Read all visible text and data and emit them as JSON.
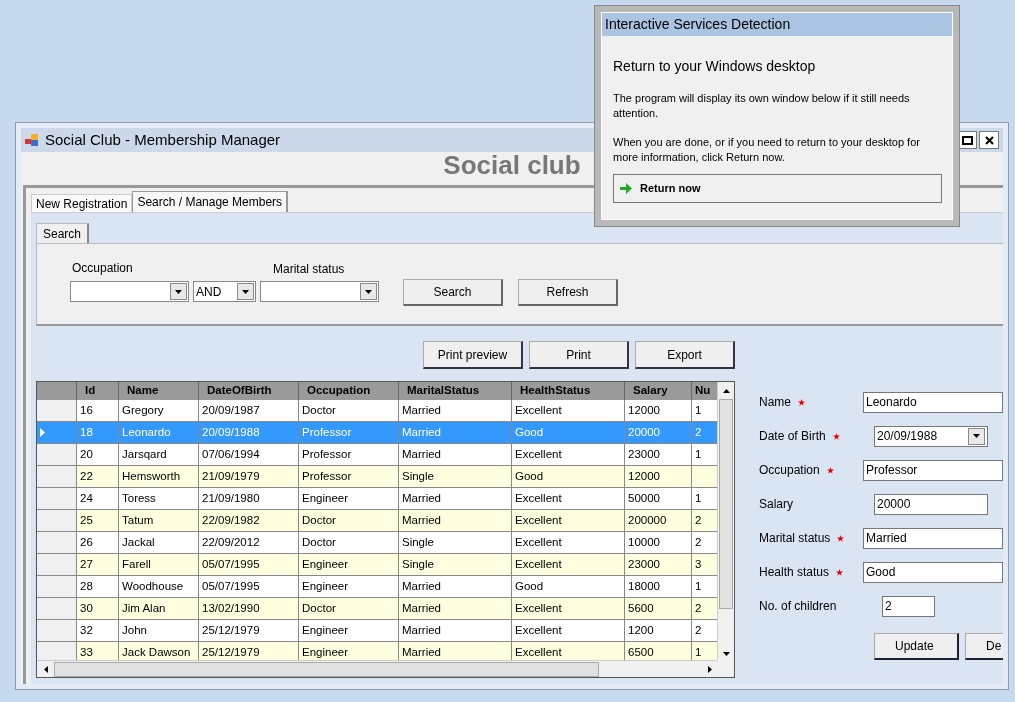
{
  "window": {
    "title": "Social Club - Membership Manager",
    "banner": "Social club"
  },
  "tabs": [
    {
      "label": "New Registration",
      "selected": false
    },
    {
      "label": "Search / Manage Members",
      "selected": true
    }
  ],
  "search": {
    "tab": "Search",
    "occupation_label": "Occupation",
    "operator": "AND",
    "marital_label": "Marital status",
    "buttons": [
      "Search",
      "Refresh"
    ]
  },
  "actions": [
    "Print preview",
    "Print",
    "Export"
  ],
  "grid": {
    "columns": [
      "Id",
      "Name",
      "DateOfBirth",
      "Occupation",
      "MaritalStatus",
      "HealthStatus",
      "Salary",
      "Nu"
    ],
    "rows": [
      {
        "selected": false,
        "cells": [
          "16",
          "Gregory",
          "20/09/1987",
          "Doctor",
          "Married",
          "Excellent",
          "12000",
          "1"
        ]
      },
      {
        "selected": true,
        "cells": [
          "18",
          "Leonardo",
          "20/09/1988",
          "Professor",
          "Married",
          "Good",
          "20000",
          "2"
        ]
      },
      {
        "selected": false,
        "cells": [
          "20",
          "Jarsqard",
          "07/06/1994",
          "Professor",
          "Married",
          "Excellent",
          "23000",
          "1"
        ]
      },
      {
        "selected": false,
        "cells": [
          "22",
          "Hemsworth",
          "21/09/1979",
          "Professor",
          "Single",
          "Good",
          "12000",
          null
        ]
      },
      {
        "selected": false,
        "cells": [
          "24",
          "Toress",
          "21/09/1980",
          "Engineer",
          "Married",
          "Excellent",
          "50000",
          "1"
        ]
      },
      {
        "selected": false,
        "cells": [
          "25",
          "Tatum",
          "22/09/1982",
          "Doctor",
          "Married",
          "Excellent",
          "200000",
          "2"
        ]
      },
      {
        "selected": false,
        "cells": [
          "26",
          "Jackal",
          "22/09/2012",
          "Doctor",
          "Single",
          "Excellent",
          "10000",
          "2"
        ]
      },
      {
        "selected": false,
        "cells": [
          "27",
          "Farell",
          "05/07/1995",
          "Engineer",
          "Single",
          "Excellent",
          "23000",
          "3"
        ]
      },
      {
        "selected": false,
        "cells": [
          "28",
          "Woodhouse",
          "05/07/1995",
          "Engineer",
          "Married",
          "Good",
          "18000",
          "1"
        ]
      },
      {
        "selected": false,
        "cells": [
          "30",
          "Jim Alan",
          "13/02/1990",
          "Doctor",
          "Married",
          "Excellent",
          "5600",
          "2"
        ]
      },
      {
        "selected": false,
        "cells": [
          "32",
          "John",
          "25/12/1979",
          "Engineer",
          "Married",
          "Excellent",
          "1200",
          "2"
        ]
      },
      {
        "selected": false,
        "cells": [
          "33",
          "Jack Dawson",
          "25/12/1979",
          "Engineer",
          "Married",
          "Excellent",
          "6500",
          "1"
        ]
      }
    ]
  },
  "details": {
    "fields": [
      {
        "kind": "text",
        "label": "Name",
        "required": true,
        "value": "Leonardo"
      },
      {
        "kind": "date",
        "label": "Date of Birth",
        "required": true,
        "value": "20/09/1988"
      },
      {
        "kind": "text",
        "label": "Occupation",
        "required": true,
        "value": "Professor"
      },
      {
        "kind": "short",
        "label": "Salary",
        "required": false,
        "value": "20000"
      },
      {
        "kind": "text",
        "label": "Marital status",
        "required": true,
        "value": "Married"
      },
      {
        "kind": "text",
        "label": "Health status",
        "required": true,
        "value": "Good"
      },
      {
        "kind": "number",
        "label": "No. of children",
        "required": false,
        "value": "2"
      }
    ],
    "buttons": [
      "Update",
      "De"
    ]
  },
  "dialog": {
    "title": "Interactive Services Detection",
    "heading": "Return to your Windows desktop",
    "paragraphs": [
      "The program will display its own window below if it still needs attention.",
      "When you are done, or if you need to return to your desktop for more information, click Return now."
    ],
    "button": "Return now"
  }
}
